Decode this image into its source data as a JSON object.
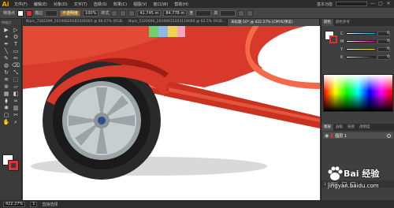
{
  "app": {
    "logo": "Ai"
  },
  "menubar": {
    "items": [
      "文件(F)",
      "编辑(E)",
      "对象(O)",
      "文字(T)",
      "选择(S)",
      "效果(C)",
      "视图(V)",
      "窗口(W)",
      "帮助(H)"
    ],
    "workspace_label": "基本功能",
    "window_buttons": [
      "—",
      "□",
      "✕"
    ]
  },
  "controlbar": {
    "selection_label": "特描点",
    "stroke_label": "描边",
    "opacity_field": "不透明度",
    "opacity_value": "100%",
    "style_label": "样式",
    "x_value": "41.745 m",
    "y_value": "84.778 m",
    "w_label": "宽",
    "h_label": "高",
    "fill_color": "#ffffff",
    "stroke_color": "#dd3333"
  },
  "tools": {
    "label": "特描点",
    "icons": [
      "selection-arrow-icon",
      "direct-selection-icon",
      "magic-wand-icon",
      "lasso-icon",
      "pen-icon",
      "type-icon",
      "line-icon",
      "rectangle-icon",
      "paintbrush-icon",
      "pencil-icon",
      "blob-brush-icon",
      "eraser-icon",
      "rotate-icon",
      "scale-icon",
      "width-icon",
      "free-transform-icon",
      "shape-builder-icon",
      "perspective-icon",
      "mesh-icon",
      "gradient-icon",
      "eyedropper-icon",
      "blend-icon",
      "symbol-sprayer-icon",
      "graph-icon",
      "artboard-icon",
      "slice-icon",
      "hand-icon",
      "zoom-icon"
    ],
    "glyphs": [
      "▶",
      "▷",
      "✦",
      "ʘ",
      "✒",
      "T",
      "╲",
      "▭",
      "✎",
      "✏",
      "◍",
      "⌫",
      "↻",
      "⤡",
      "≋",
      "⬚",
      "⊕",
      "▱",
      "▦",
      "◧",
      "⧫",
      "∞",
      "✺",
      "▥",
      "▢",
      "✂",
      "✋",
      "⌕"
    ],
    "fill_color": "#ffffff",
    "stroke_color": "#dd3333"
  },
  "document_tabs": [
    {
      "label": "Nipic_7282299_20190820183329303 @ 66.67% (RGB...",
      "active": false
    },
    {
      "label": "Nipic_5320690_20190615203118000 @ 62.5% (RGB...",
      "active": false
    },
    {
      "label": "未标题-10* @ 422.27% (CMYK/预览)",
      "active": true
    }
  ],
  "status": {
    "zoom": "422.27%",
    "page": "1",
    "tool": "直接选择"
  },
  "color_panel": {
    "tabs": [
      "颜色",
      "颜色参考"
    ],
    "sliders": [
      {
        "letter": "C",
        "value": "0",
        "color": "#00a0e0"
      },
      {
        "letter": "M",
        "value": "0",
        "color": "#e0008a"
      },
      {
        "letter": "Y",
        "value": "0",
        "color": "#f0e000"
      },
      {
        "letter": "K",
        "value": "0",
        "color": "#222222"
      }
    ]
  },
  "layers_panel": {
    "tabs": [
      "图层",
      "画板",
      "链接",
      "透明度"
    ],
    "layer_name": "图层 1",
    "footer": "1 个图层"
  },
  "watermark": {
    "brand": "Bai 经验",
    "url": "jingyan.baidu.com"
  }
}
